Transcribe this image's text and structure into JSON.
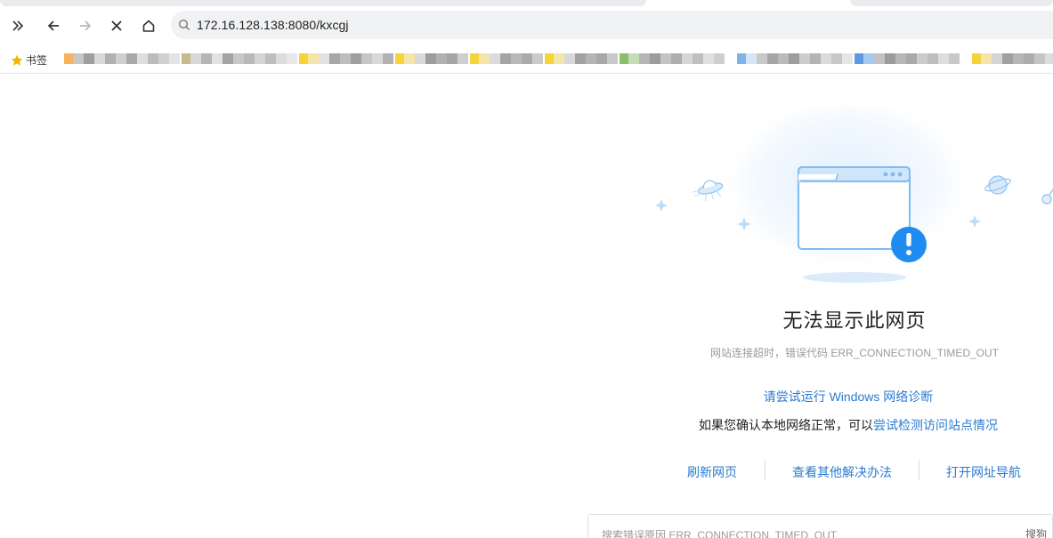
{
  "browser": {
    "url": "172.16.128.138:8080/kxcgj",
    "bookmarks_label": "书签",
    "bookmark_items": [
      {
        "fav": "#f6b35c",
        "px": [
          "#c7c7c7",
          "#9e9e9e",
          "#d9d9d9",
          "#b0b0b0",
          "#cfcfcf",
          "#a9a9a9",
          "#dedede",
          "#bcbcbc",
          "#d0d0d0",
          "#e4e4e4"
        ]
      },
      {
        "fav": "#c9b98c",
        "px": [
          "#d7d7d7",
          "#b5b5b5",
          "#e2e2e2",
          "#a3a3a3",
          "#c8c8c8",
          "#b8b8b8",
          "#d4d4d4",
          "#c0bcc0",
          "#dcdcdc",
          "#e8e8e8"
        ]
      },
      {
        "fav": "#f5d43a",
        "px": [
          "#f3e6a8",
          "#e1e1e1",
          "#a7a7a7",
          "#bdbdbd",
          "#9f9f9f",
          "#c6c6c6",
          "#d8d8d8",
          "#b2b2b2"
        ]
      },
      {
        "fav": "#f5d43a",
        "px": [
          "#f3e6a8",
          "#dadada",
          "#9d9d9d",
          "#b1b1b1",
          "#a5a5a5",
          "#cfcfcf"
        ]
      },
      {
        "fav": "#f5d43a",
        "px": [
          "#f3e6a8",
          "#dcdcdc",
          "#a4a4a4",
          "#b9b9b9",
          "#aaaaaa",
          "#cbcbcb"
        ]
      },
      {
        "fav": "#f5d43a",
        "px": [
          "#f3e6a8",
          "#d8d8d8",
          "#a2a2a2",
          "#b4b4b4",
          "#a8a8a8",
          "#c9c9c9"
        ]
      },
      {
        "fav": "#8bbf6a",
        "px": [
          "#c6dcb6",
          "#b5b5b5",
          "#9c9c9c",
          "#c4c4c4",
          "#aeaeae",
          "#d6d6d6",
          "#bfbfbf",
          "#e0e0e0",
          "#cfcfcf"
        ]
      },
      {
        "fav": "#7db4ea",
        "px": [
          "#d6e6f6",
          "#c9c9c9",
          "#a6a6a6",
          "#bababa",
          "#9e9e9e",
          "#cdcdcd",
          "#b3b3b3",
          "#dbdbdb",
          "#c7c7c7",
          "#e5e5e5"
        ]
      },
      {
        "fav": "#5c9be3",
        "px": [
          "#a7c8ef",
          "#c2c2c2",
          "#9b9b9b",
          "#b7b7b7",
          "#a9a9a9",
          "#cccccc",
          "#bdbdbd",
          "#dedede",
          "#c8c8c8"
        ]
      },
      {
        "fav": "#f5d43a",
        "px": [
          "#f3e6a8",
          "#d4d4d4",
          "#a0a0a0",
          "#b6b6b6",
          "#acacac",
          "#c4c4c4",
          "#dddddd"
        ]
      }
    ]
  },
  "error_page": {
    "title": "无法显示此网页",
    "subtitle": "网站连接超时，错误代码 ERR_CONNECTION_TIMED_OUT",
    "diagnose_link": "请尝试运行 Windows 网络诊断",
    "check_prefix": "如果您确认本地网络正常，可以",
    "check_link": "尝试检测访问站点情况",
    "actions": {
      "refresh": "刷新网页",
      "other_solutions": "查看其他解决办法",
      "nav": "打开网址导航"
    },
    "search": {
      "placeholder": "搜索错误原因 ERR_CONNECTION_TIMED_OUT",
      "engine": "搜狗"
    }
  },
  "colors": {
    "link": "#2b7bd0",
    "alert": "#1e8cf0",
    "illustration_stroke": "#7fbbf0"
  }
}
